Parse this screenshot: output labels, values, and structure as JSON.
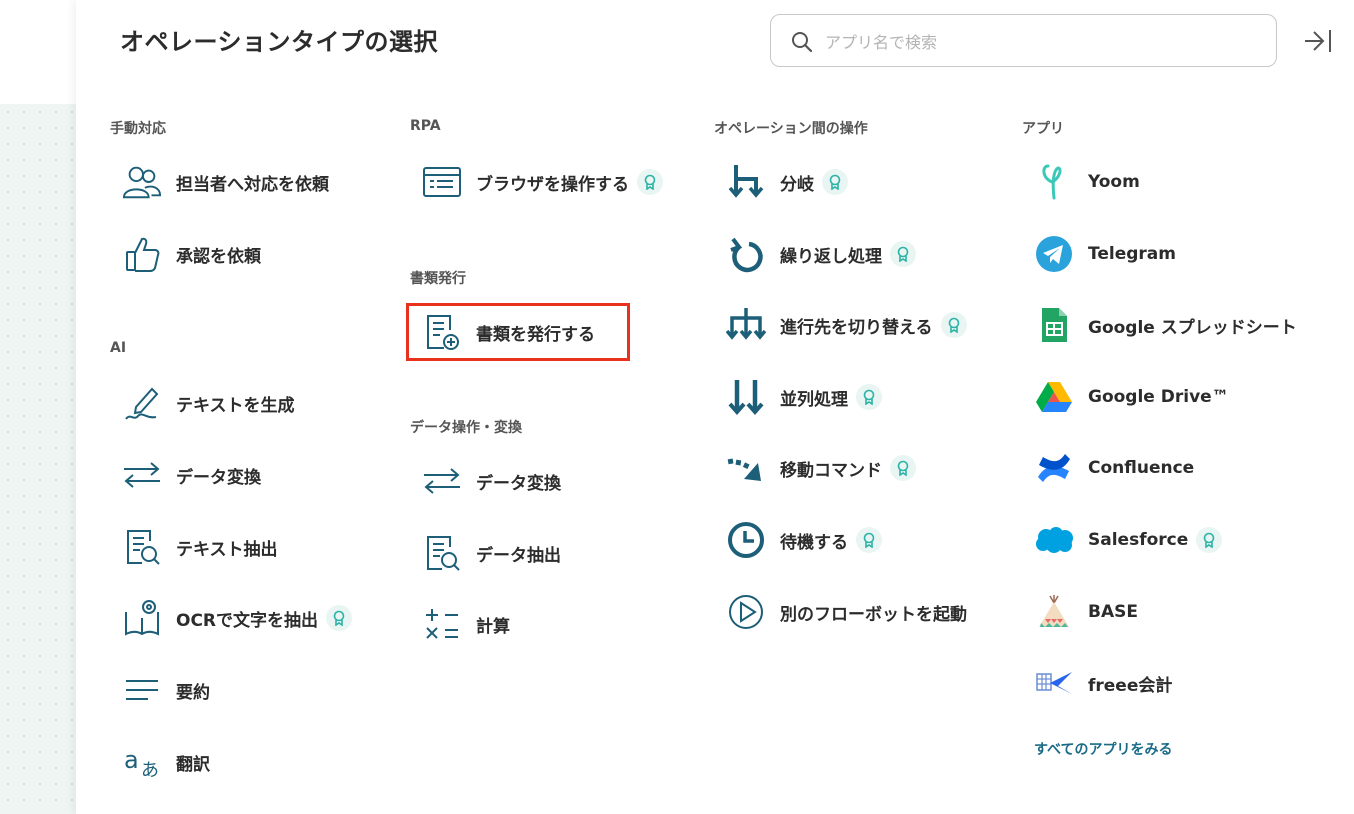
{
  "header": {
    "title": "オペレーションタイプの選択",
    "search_placeholder": "アプリ名で検索"
  },
  "colors": {
    "accent": "#1d5f78",
    "highlight": "#e8321e",
    "badge_bg": "#e8f5f3",
    "badge_icon": "#2bb3a5"
  },
  "manual": {
    "section": "手動対応",
    "items": [
      {
        "label": "担当者へ対応を依頼",
        "icon": "people-icon"
      },
      {
        "label": "承認を依頼",
        "icon": "thumbs-up-icon"
      }
    ]
  },
  "ai": {
    "section": "AI",
    "items": [
      {
        "label": "テキストを生成",
        "icon": "pen-icon"
      },
      {
        "label": "データ変換",
        "icon": "arrows-swap-icon"
      },
      {
        "label": "テキスト抽出",
        "icon": "document-search-icon"
      },
      {
        "label": "OCRで文字を抽出",
        "icon": "ocr-book-icon",
        "premium": true
      },
      {
        "label": "要約",
        "icon": "lines-icon"
      },
      {
        "label": "翻訳",
        "icon": "translate-icon"
      }
    ]
  },
  "rpa": {
    "section": "RPA",
    "items": [
      {
        "label": "ブラウザを操作する",
        "icon": "browser-icon",
        "premium": true
      }
    ]
  },
  "docs": {
    "section": "書類発行",
    "items": [
      {
        "label": "書類を発行する",
        "icon": "document-add-icon"
      }
    ]
  },
  "data_ops": {
    "section": "データ操作・変換",
    "items": [
      {
        "label": "データ変換",
        "icon": "arrows-swap-icon"
      },
      {
        "label": "データ抽出",
        "icon": "document-search-icon"
      },
      {
        "label": "計算",
        "icon": "calculator-icon"
      }
    ]
  },
  "between": {
    "section": "オペレーション間の操作",
    "items": [
      {
        "label": "分岐",
        "icon": "branch-icon",
        "premium": true
      },
      {
        "label": "繰り返し処理",
        "icon": "loop-icon",
        "premium": true
      },
      {
        "label": "進行先を切り替える",
        "icon": "switch-path-icon",
        "premium": true
      },
      {
        "label": "並列処理",
        "icon": "parallel-icon",
        "premium": true
      },
      {
        "label": "移動コマンド",
        "icon": "move-command-icon",
        "premium": true
      },
      {
        "label": "待機する",
        "icon": "clock-icon",
        "premium": true
      },
      {
        "label": "別のフローボットを起動",
        "icon": "play-icon"
      }
    ]
  },
  "apps": {
    "section": "アプリ",
    "items": [
      {
        "label": "Yoom",
        "icon": "yoom-logo-icon"
      },
      {
        "label": "Telegram",
        "icon": "telegram-logo-icon"
      },
      {
        "label": "Google スプレッドシート",
        "icon": "google-sheets-logo-icon"
      },
      {
        "label": "Google Drive™",
        "icon": "google-drive-logo-icon"
      },
      {
        "label": "Confluence",
        "icon": "confluence-logo-icon"
      },
      {
        "label": "Salesforce",
        "icon": "salesforce-logo-icon",
        "premium": true
      },
      {
        "label": "BASE",
        "icon": "base-logo-icon"
      },
      {
        "label": "freee会計",
        "icon": "freee-logo-icon"
      }
    ],
    "see_all": "すべてのアプリをみる"
  }
}
